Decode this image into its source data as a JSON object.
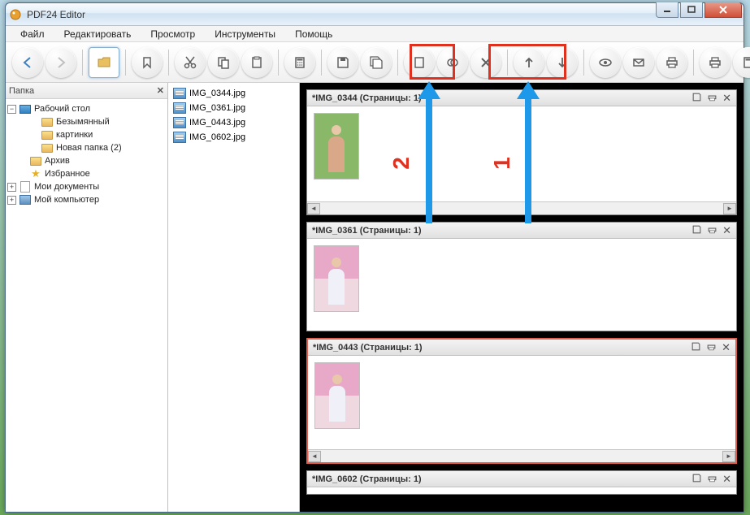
{
  "window": {
    "title": "PDF24 Editor"
  },
  "menu": {
    "file": "Файл",
    "edit": "Редактировать",
    "view": "Просмотр",
    "tools": "Инструменты",
    "help": "Помощь"
  },
  "sidebar": {
    "header": "Папка",
    "items": [
      {
        "label": "Рабочий стол",
        "icon": "desktop",
        "expand": "minus",
        "indent": 0
      },
      {
        "label": "Безымянный",
        "icon": "folder",
        "expand": "none",
        "indent": 2
      },
      {
        "label": "картинки",
        "icon": "folder",
        "expand": "none",
        "indent": 2
      },
      {
        "label": "Новая папка (2)",
        "icon": "folder",
        "expand": "none",
        "indent": 2
      },
      {
        "label": "Архив",
        "icon": "folder",
        "expand": "none",
        "indent": 1
      },
      {
        "label": "Избранное",
        "icon": "star",
        "expand": "none",
        "indent": 1
      },
      {
        "label": "Мои документы",
        "icon": "doc",
        "expand": "plus",
        "indent": 0
      },
      {
        "label": "Мой компьютер",
        "icon": "comp",
        "expand": "plus",
        "indent": 0
      }
    ]
  },
  "files": [
    {
      "name": "IMG_0344.jpg"
    },
    {
      "name": "IMG_0361.jpg"
    },
    {
      "name": "IMG_0443.jpg"
    },
    {
      "name": "IMG_0602.jpg"
    }
  ],
  "docs": [
    {
      "title": "*IMG_0344 (Страницы: 1)",
      "thumb": "green",
      "scroll": true,
      "selected": false
    },
    {
      "title": "*IMG_0361 (Страницы: 1)",
      "thumb": "pink",
      "scroll": false,
      "selected": false
    },
    {
      "title": "*IMG_0443 (Страницы: 1)",
      "thumb": "pink",
      "scroll": true,
      "selected": true
    },
    {
      "title": "*IMG_0602 (Страницы: 1)",
      "thumb": "green",
      "scroll": false,
      "selected": false
    }
  ],
  "annotations": {
    "num1": "1",
    "num2": "2"
  },
  "icons": {
    "save": "save",
    "print": "print",
    "close": "close"
  }
}
